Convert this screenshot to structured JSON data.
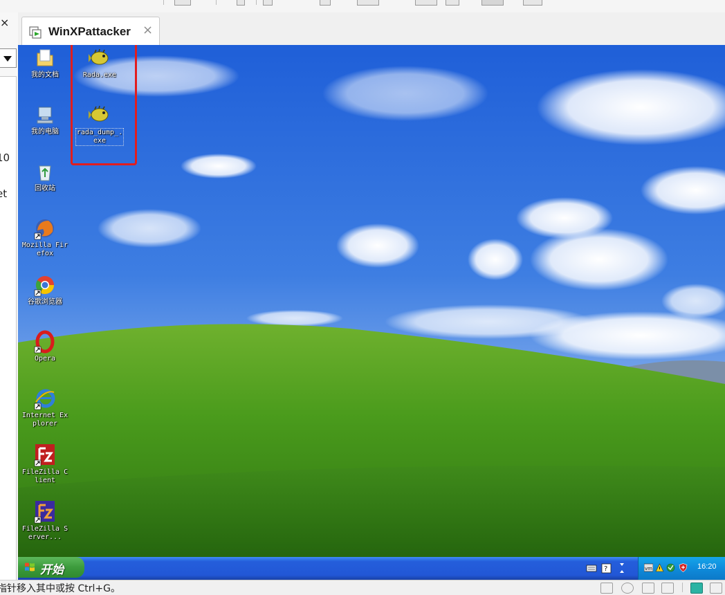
{
  "tab": {
    "title": "WinXPattacker",
    "close": "×"
  },
  "left_panel": {
    "close": "×",
    "text_10": "10",
    "text_et": "et"
  },
  "desktop": {
    "icons": [
      {
        "label": "我的文档"
      },
      {
        "label": "Rada.exe"
      },
      {
        "label": "我的电脑"
      },
      {
        "label": "rada_dump_.exe"
      },
      {
        "label": "回收站"
      },
      {
        "label": "Mozilla Firefox"
      },
      {
        "label": "谷歌浏览器"
      },
      {
        "label": "Opera"
      },
      {
        "label": "Internet Explorer"
      },
      {
        "label": "FileZilla Client"
      },
      {
        "label": "FileZilla Server..."
      }
    ]
  },
  "taskbar": {
    "start_label": "开始",
    "clock": "16:20"
  },
  "status_bar": {
    "message": "指针移入其中或按 Ctrl+G。"
  },
  "colors": {
    "highlight": "#e21d1d",
    "taskbar": "#245edb",
    "start": "#3c9b3c"
  }
}
